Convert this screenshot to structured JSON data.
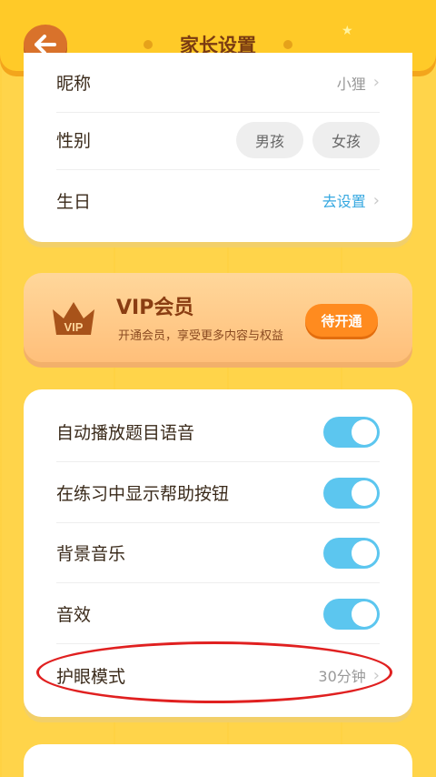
{
  "header": {
    "title": "家长设置",
    "back_icon": "arrow-left-icon"
  },
  "profile": {
    "nickname_label": "昵称",
    "nickname_value": "小狸",
    "gender_label": "性别",
    "gender_options": [
      "男孩",
      "女孩"
    ],
    "birthday_label": "生日",
    "birthday_value": "去设置"
  },
  "vip": {
    "badge_text": "VIP",
    "title": "VIP会员",
    "subtitle": "开通会员，享受更多内容与权益",
    "button": "待开通"
  },
  "settings": {
    "items": [
      {
        "label": "自动播放题目语音",
        "on": true
      },
      {
        "label": "在练习中显示帮助按钮",
        "on": true
      },
      {
        "label": "背景音乐",
        "on": true
      },
      {
        "label": "音效",
        "on": true
      }
    ],
    "eye_mode_label": "护眼模式",
    "eye_mode_value": "30分钟"
  },
  "colors": {
    "accent_blue": "#5cc6ef",
    "vip_orange": "#ff8b1f",
    "header": "#ffca28",
    "highlight": "#e02020"
  }
}
